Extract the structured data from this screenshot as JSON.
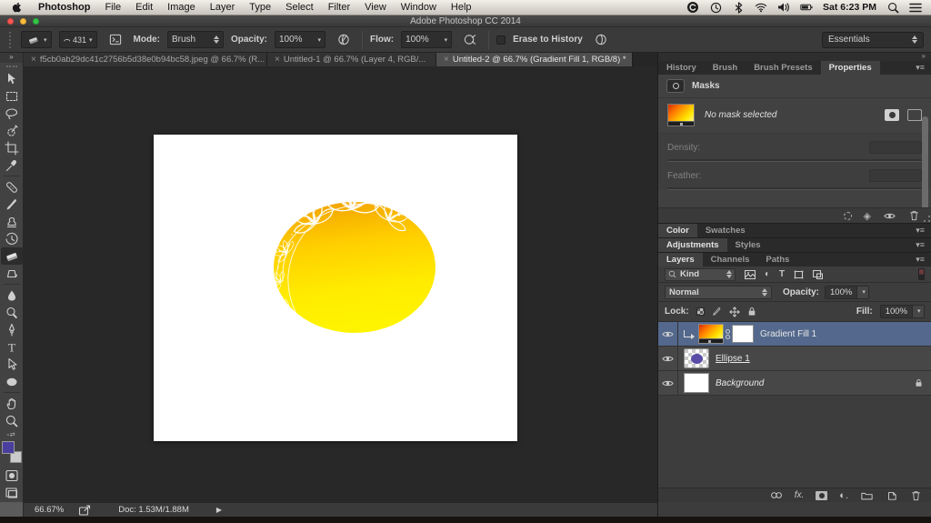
{
  "menubar": {
    "items": [
      "Photoshop",
      "File",
      "Edit",
      "Image",
      "Layer",
      "Type",
      "Select",
      "Filter",
      "View",
      "Window",
      "Help"
    ],
    "time": "Sat 6:23 PM"
  },
  "window": {
    "title": "Adobe Photoshop CC 2014"
  },
  "options": {
    "brush_size": "431",
    "mode_label": "Mode:",
    "mode_value": "Brush",
    "opacity_label": "Opacity:",
    "opacity_value": "100%",
    "flow_label": "Flow:",
    "flow_value": "100%",
    "erase_history_label": "Erase to History",
    "workspace": "Essentials"
  },
  "tabs": [
    {
      "title": "f5cb0ab29dc41c2756b5d38e0b94bc58.jpeg @ 66.7% (R...",
      "close": "×",
      "active": false
    },
    {
      "title": "Untitled-1 @ 66.7% (Layer 4, RGB/...",
      "close": "×",
      "active": false
    },
    {
      "title": "Untitled-2 @ 66.7% (Gradient Fill 1, RGB/8) *",
      "close": "×",
      "active": true
    }
  ],
  "properties_panel": {
    "tabs": [
      "History",
      "Brush",
      "Brush Presets",
      "Properties"
    ],
    "header": "Masks",
    "no_mask_text": "No mask selected",
    "density_label": "Density:",
    "feather_label": "Feather:"
  },
  "color_tabs": [
    "Color",
    "Swatches"
  ],
  "adjustment_tabs": [
    "Adjustments",
    "Styles"
  ],
  "layers_tabs": [
    "Layers",
    "Channels",
    "Paths"
  ],
  "layers_panel": {
    "filter_label": "Kind",
    "blend_mode": "Normal",
    "opacity_label": "Opacity:",
    "opacity_value": "100%",
    "lock_label": "Lock:",
    "fill_label": "Fill:",
    "fill_value": "100%",
    "layers": [
      {
        "name": "Gradient Fill 1",
        "selected": true
      },
      {
        "name": "Ellipse 1",
        "selected": false
      },
      {
        "name": "Background",
        "selected": false
      }
    ]
  },
  "statusbar": {
    "zoom": "66.67%",
    "doc": "Doc: 1.53M/1.88M"
  },
  "icons": {
    "menubar_status": [
      "creative-cloud",
      "clock",
      "bluetooth",
      "wifi",
      "volume",
      "battery",
      "spotlight",
      "notification-center"
    ],
    "tools": [
      "move",
      "marquee",
      "lasso",
      "quick-selection",
      "crop",
      "eyedropper",
      "spot-healing",
      "brush",
      "clone-stamp",
      "history-brush",
      "eraser",
      "gradient",
      "blur",
      "dodge",
      "pen",
      "type",
      "path-selection",
      "ellipse",
      "hand",
      "zoom"
    ]
  },
  "colors": {
    "selection_blue": "#53688c",
    "foreground_swatch": "#4a3f9e",
    "ellipse_shape": "#584ca6",
    "ellipse_gradient_top": "#f3a000",
    "ellipse_gradient_bottom": "#fff500"
  }
}
